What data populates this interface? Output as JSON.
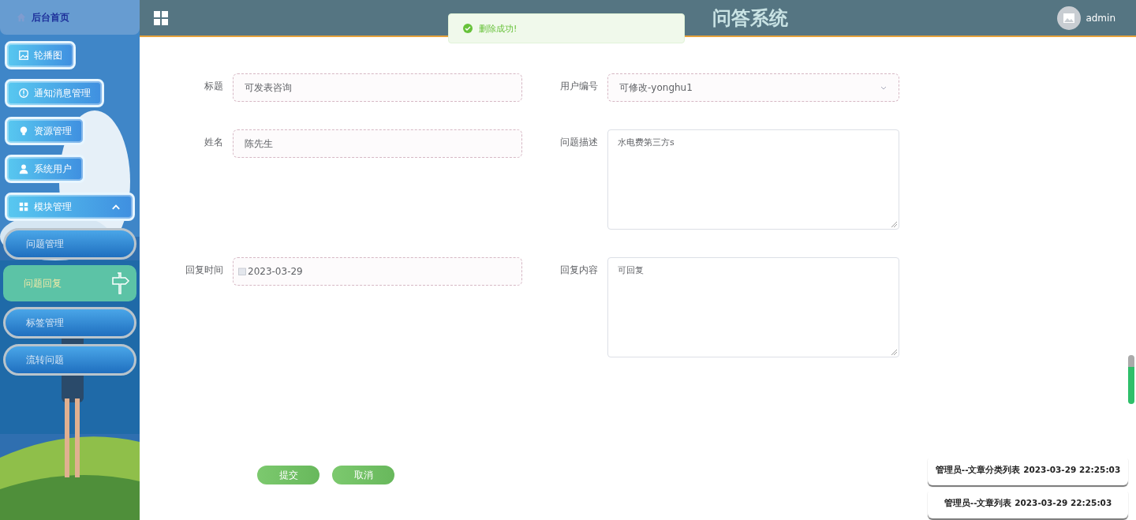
{
  "header": {
    "title": "问答系统",
    "user": "admin"
  },
  "toast": {
    "message": "删除成功!"
  },
  "sidebar": {
    "home": "后台首页",
    "items": [
      {
        "kind": "main",
        "label": "轮播图"
      },
      {
        "kind": "main",
        "label": "通知消息管理"
      },
      {
        "kind": "main",
        "label": "资源管理"
      },
      {
        "kind": "main",
        "label": "系统用户"
      },
      {
        "kind": "main",
        "label": "模块管理",
        "expanded": true,
        "children": [
          {
            "label": "问题管理",
            "selected": false
          },
          {
            "label": "问题回复",
            "selected": true
          },
          {
            "label": "标签管理",
            "selected": false
          },
          {
            "label": "流转问题",
            "selected": false
          }
        ]
      }
    ]
  },
  "form": {
    "fields": [
      {
        "kind": "text",
        "label": "标题",
        "value": "可发表咨询"
      },
      {
        "kind": "select",
        "label": "用户编号",
        "value": "可修改-yonghu1"
      },
      {
        "kind": "text",
        "label": "姓名",
        "value": "陈先生"
      },
      {
        "kind": "textarea",
        "label": "问题描述",
        "value": "水电费第三方s"
      },
      {
        "kind": "date",
        "label": "回复时间",
        "value": "2023-03-29"
      },
      {
        "kind": "textarea",
        "label": "回复内容",
        "value": "可回复"
      }
    ],
    "buttons": [
      "提交",
      "取消"
    ]
  },
  "log": {
    "items": [
      "管理员--文章分类列表 2023-03-29 22:25:03",
      "管理员--文章列表 2023-03-29 22:25:03"
    ]
  }
}
